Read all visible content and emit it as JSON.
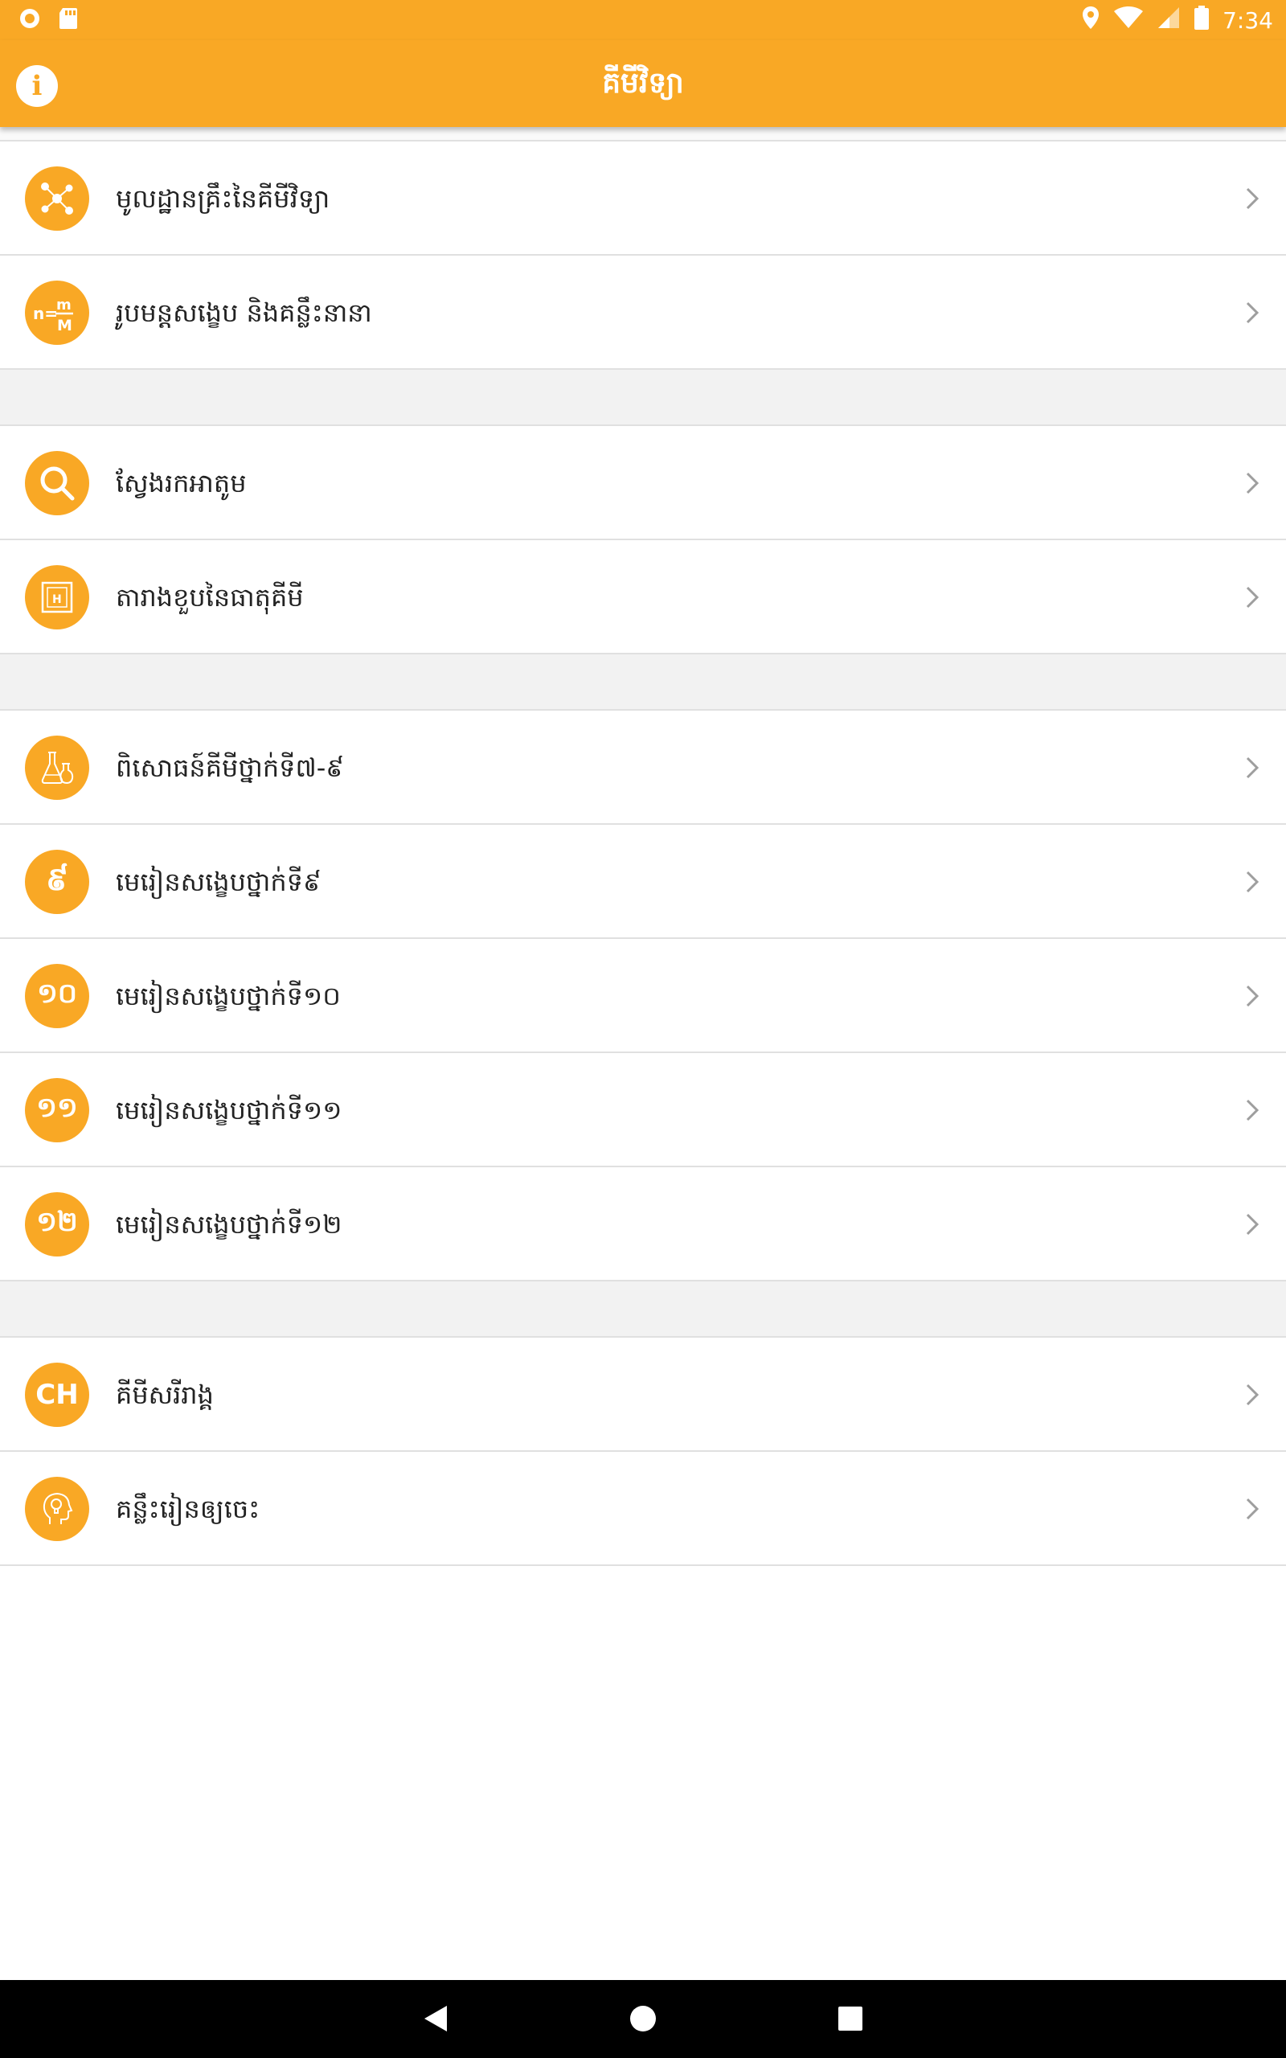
{
  "status_bar": {
    "time": "7:34",
    "icons": [
      "record-icon",
      "sd-card-icon",
      "location-icon",
      "wifi-icon",
      "signal-icon",
      "battery-icon"
    ]
  },
  "app_bar": {
    "title": "គីមីវិទ្យា",
    "info_icon": "info-icon",
    "info_glyph": "i"
  },
  "colors": {
    "accent": "#f9a825",
    "divider": "#e0e0e0",
    "section_gap": "#f2f2f2",
    "text": "#222222",
    "chevron": "#9e9e9e"
  },
  "menu": {
    "group1": [
      {
        "label": "មូលដ្ឋានគ្រឹះនៃគីមីវិទ្យា",
        "icon": "molecule-icon"
      },
      {
        "label": "រូបមន្តសង្ខេប និងគន្លឹះនានា",
        "icon": "formula-icon",
        "icon_text": "n=m/M"
      }
    ],
    "group2": [
      {
        "label": "ស្វែងរកអាតូម",
        "icon": "search-icon"
      },
      {
        "label": "តារាងខួបនៃធាតុគីមី",
        "icon": "periodic-table-icon",
        "icon_text": "H"
      }
    ],
    "group3": [
      {
        "label": "ពិសោធន៍គីមីថ្នាក់ទី៧-៩",
        "icon": "flask-icon"
      },
      {
        "label": "មេរៀនសង្ខេបថ្នាក់ទី៩",
        "icon": "grade-9-icon",
        "icon_text": "៩"
      },
      {
        "label": "មេរៀនសង្ខេបថ្នាក់ទី១០",
        "icon": "grade-10-icon",
        "icon_text": "១០"
      },
      {
        "label": "មេរៀនសង្ខេបថ្នាក់ទី១១",
        "icon": "grade-11-icon",
        "icon_text": "១១"
      },
      {
        "label": "មេរៀនសង្ខេបថ្នាក់ទី១២",
        "icon": "grade-12-icon",
        "icon_text": "១២"
      }
    ],
    "group4": [
      {
        "label": "គីមីសរីរាង្គ",
        "icon": "organic-chemistry-icon",
        "icon_text": "CH"
      },
      {
        "label": "គន្លឹះរៀនឲ្យចេះ",
        "icon": "head-bulb-icon"
      }
    ]
  },
  "nav_bar": {
    "icons": [
      "back-icon",
      "home-icon",
      "recents-icon"
    ]
  }
}
